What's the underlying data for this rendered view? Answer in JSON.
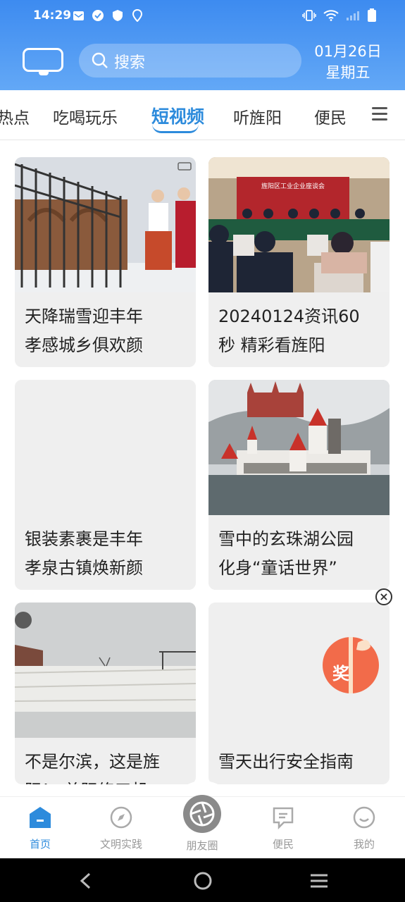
{
  "status": {
    "time": "14:29"
  },
  "header": {
    "search_placeholder": "搜索",
    "date_line1": "01月26日",
    "date_line2": "星期五"
  },
  "tabs": [
    {
      "label": "热点"
    },
    {
      "label": "吃喝玩乐"
    },
    {
      "label": "短视频"
    },
    {
      "label": "听旌阳"
    },
    {
      "label": "便民"
    }
  ],
  "cards": [
    {
      "line1": "天降瑞雪迎丰年",
      "line2": "孝感城乡俱欢颜"
    },
    {
      "line1": "20240124资讯60",
      "line2": "秒  精彩看旌阳"
    },
    {
      "line1": "银装素裹是丰年",
      "line2": "孝泉古镇焕新颜"
    },
    {
      "line1": "雪中的玄珠湖公园",
      "line2": "化身“童话世界”"
    },
    {
      "line1": "不是尔滨，这是旌",
      "line2": "阳！ 总阳修三机"
    },
    {
      "line1": "雪天出行安全指南",
      "line2": ""
    }
  ],
  "thumbs": {
    "card2_banner": "旌阳区工业企业座谈会"
  },
  "prize": {
    "label": "奖"
  },
  "nav": [
    {
      "label": "首页"
    },
    {
      "label": "文明实践"
    },
    {
      "label": "朋友圈"
    },
    {
      "label": "便民"
    },
    {
      "label": "我的"
    }
  ],
  "colors": {
    "accent": "#2d8bdc",
    "header": "#4a97f2"
  }
}
